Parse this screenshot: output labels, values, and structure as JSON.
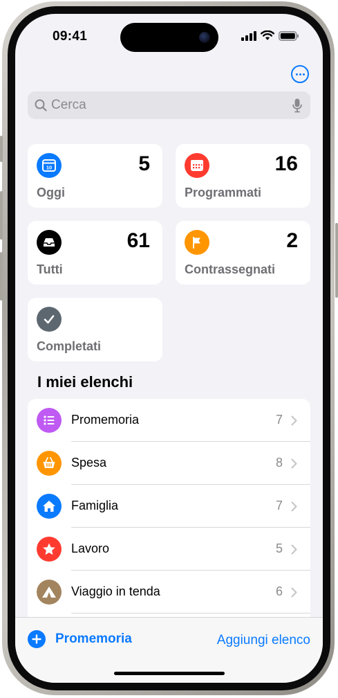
{
  "status_bar": {
    "time": "09:41"
  },
  "search": {
    "placeholder": "Cerca"
  },
  "smart_lists": [
    {
      "label": "Oggi",
      "count": "5",
      "color": "#0a7aff",
      "icon": "calendar-today-icon",
      "day": "10"
    },
    {
      "label": "Programmati",
      "count": "16",
      "color": "#ff3b30",
      "icon": "calendar-grid-icon"
    },
    {
      "label": "Tutti",
      "count": "61",
      "color": "#000000",
      "icon": "tray-icon"
    },
    {
      "label": "Contrassegnati",
      "count": "2",
      "color": "#ff9500",
      "icon": "flag-icon"
    },
    {
      "label": "Completati",
      "count": "",
      "color": "#5d6770",
      "icon": "checkmark-icon"
    }
  ],
  "my_lists": {
    "title": "I miei elenchi",
    "items": [
      {
        "name": "Promemoria",
        "count": "7",
        "color": "#bf5af2",
        "icon": "list-bullet-icon"
      },
      {
        "name": "Spesa",
        "count": "8",
        "color": "#ff9500",
        "icon": "basket-icon"
      },
      {
        "name": "Famiglia",
        "count": "7",
        "color": "#0a7aff",
        "icon": "house-icon"
      },
      {
        "name": "Lavoro",
        "count": "5",
        "color": "#ff3b30",
        "icon": "star-icon"
      },
      {
        "name": "Viaggio in tenda",
        "count": "6",
        "color": "#a2845e",
        "icon": "tent-icon"
      }
    ]
  },
  "toolbar": {
    "new_reminder": "Promemoria",
    "add_list": "Aggiungi elenco"
  },
  "colors": {
    "accent": "#0a7aff",
    "background": "#f2f2f7"
  }
}
